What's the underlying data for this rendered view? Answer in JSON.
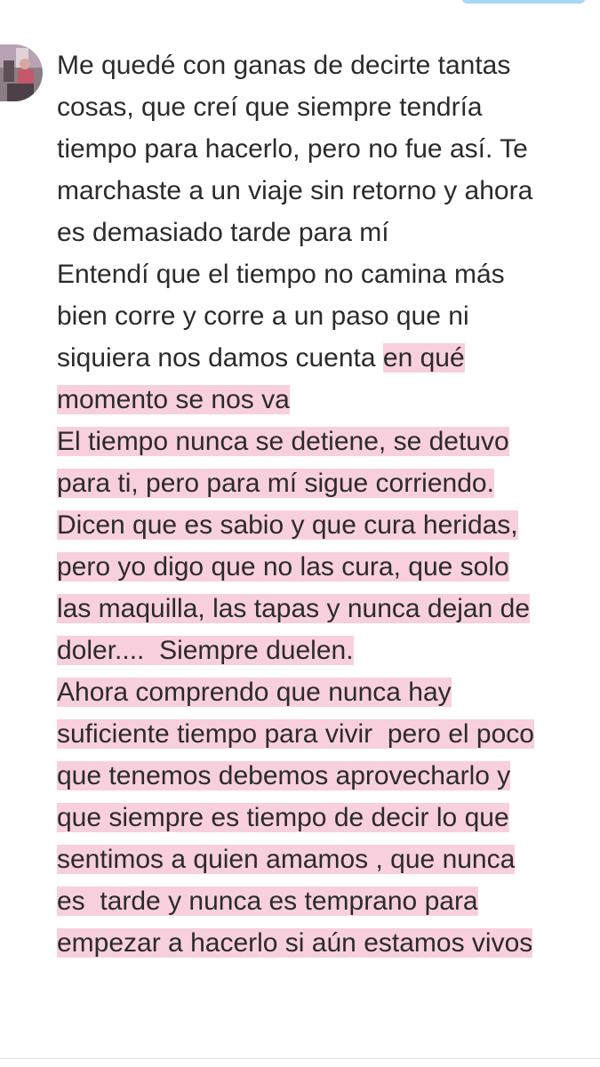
{
  "post": {
    "lines": [
      {
        "plain": "Me quedé con ganas de decirte tantas",
        "highlighted": ""
      },
      {
        "plain": "cosas, que creí que siempre tendría",
        "highlighted": ""
      },
      {
        "plain": "tiempo para hacerlo, pero no fue así. Te",
        "highlighted": ""
      },
      {
        "plain": "marchaste a un viaje sin retorno y ahora",
        "highlighted": ""
      },
      {
        "plain": "es demasiado tarde para mí",
        "highlighted": ""
      },
      {
        "plain": "Entendí que el tiempo no camina más",
        "highlighted": ""
      },
      {
        "plain": "bien corre y corre a un paso que ni",
        "highlighted": ""
      },
      {
        "plain": "siquiera nos damos cuenta ",
        "highlighted": "en qué"
      },
      {
        "plain": "",
        "highlighted": "momento se nos va"
      },
      {
        "plain": "",
        "highlighted": "El tiempo nunca se detiene, se detuvo"
      },
      {
        "plain": "",
        "highlighted": "para ti, pero para mí sigue corriendo."
      },
      {
        "plain": "",
        "highlighted": "Dicen que es sabio y que cura heridas,"
      },
      {
        "plain": "",
        "highlighted": "pero yo digo que no las cura, que solo"
      },
      {
        "plain": "",
        "highlighted": "las maquilla, las tapas y nunca dejan de"
      },
      {
        "plain": "",
        "highlighted": "doler....  Siempre duelen."
      },
      {
        "plain": "",
        "highlighted": "Ahora comprendo que nunca hay"
      },
      {
        "plain": "",
        "highlighted": "suficiente tiempo para vivir  pero el poco"
      },
      {
        "plain": "",
        "highlighted": "que tenemos debemos aprovecharlo y"
      },
      {
        "plain": "",
        "highlighted": "que siempre es tiempo de decir lo que"
      },
      {
        "plain": "",
        "highlighted": "sentimos a quien amamos , que nunca"
      },
      {
        "plain": "",
        "highlighted": "es  tarde y nunca es temprano para"
      },
      {
        "plain": "",
        "highlighted": "empezar a hacerlo si aún estamos vivos"
      }
    ]
  },
  "colors": {
    "text": "#2b2b2b",
    "highlight": "#f8d0dd",
    "top_pill": "#a9d8f5"
  },
  "icons": {
    "avatar": "user-avatar-photo"
  }
}
